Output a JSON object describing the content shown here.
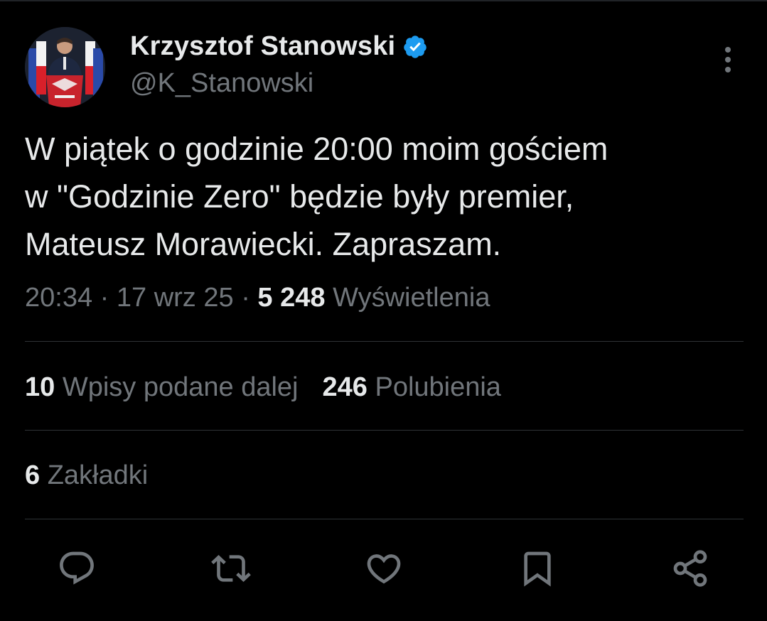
{
  "author": {
    "name": "Krzysztof Stanowski",
    "handle": "@K_Stanowski",
    "verified": true,
    "verified_color": "#1d9bf0"
  },
  "tweet": {
    "text": "W piątek o godzinie 20:00 moim gościem\nw \"Godzinie Zero\" będzie były premier,\nMateusz Morawiecki. Zapraszam.",
    "time": "20:34",
    "date": "17 wrz 25",
    "separator": "·",
    "views_count": "5 248",
    "views_label": "Wyświetlenia"
  },
  "stats": {
    "reposts_count": "10",
    "reposts_label": "Wpisy podane dalej",
    "likes_count": "246",
    "likes_label": "Polubienia",
    "bookmarks_count": "6",
    "bookmarks_label": "Zakładki"
  },
  "actions": {
    "reply_icon": "reply-icon",
    "repost_icon": "repost-icon",
    "like_icon": "heart-icon",
    "bookmark_icon": "bookmark-icon",
    "share_icon": "share-icon"
  },
  "colors": {
    "background": "#000000",
    "text_primary": "#e7e9ea",
    "text_secondary": "#71767b",
    "divider": "#2f3336"
  }
}
